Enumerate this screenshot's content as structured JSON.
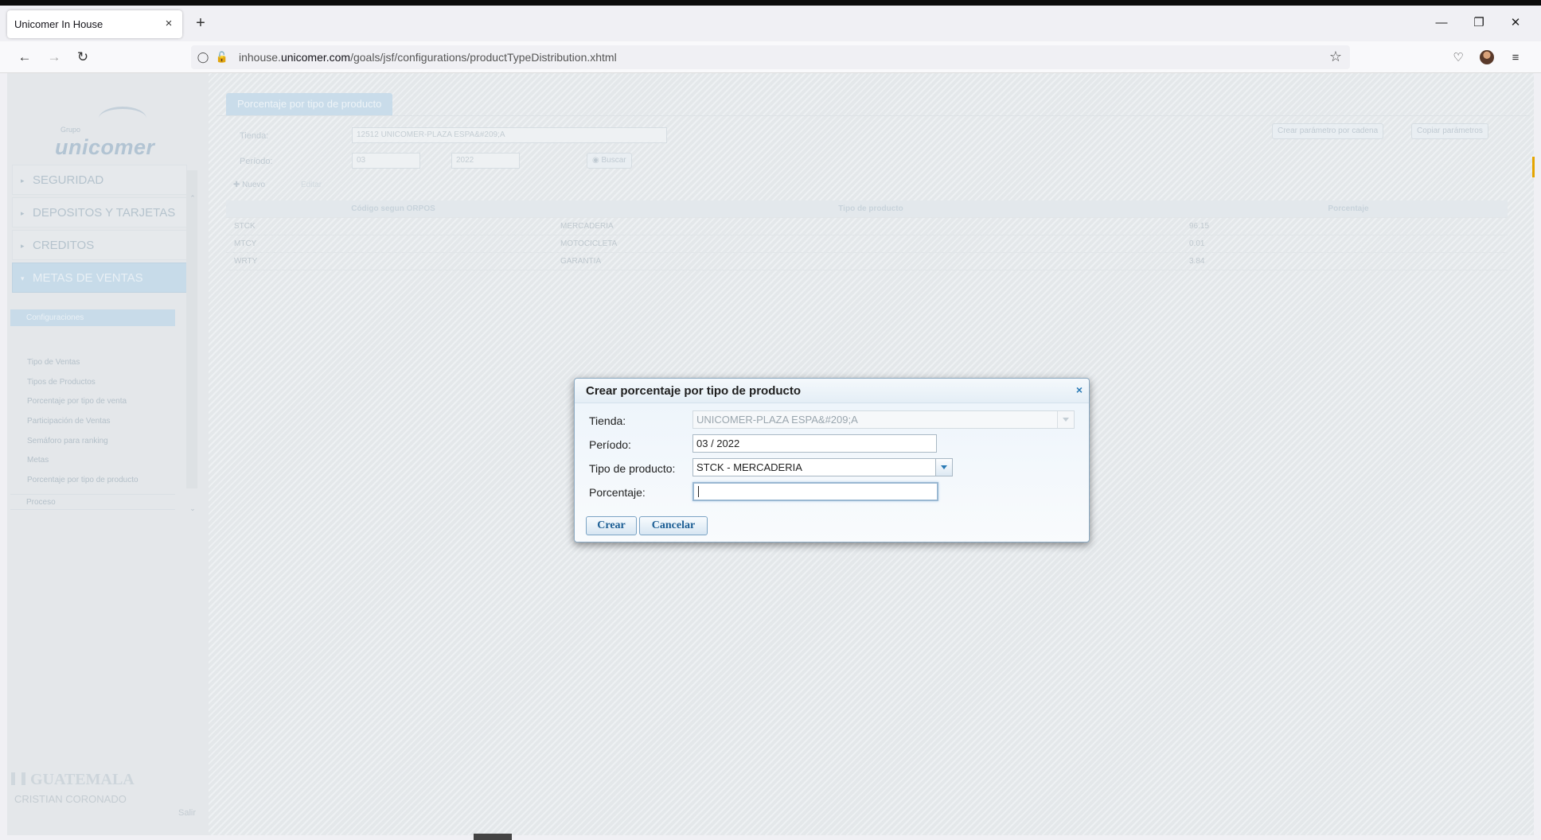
{
  "browser": {
    "tab_title": "Unicomer In House",
    "tab_close": "×",
    "new_tab": "+",
    "url_prefix": "inhouse.",
    "url_domain": "unicomer.com",
    "url_path": "/goals/jsf/configurations/productTypeDistribution.xhtml"
  },
  "sidebar": {
    "logo_small": "Grupo",
    "logo": "unicomer",
    "menu": [
      {
        "label": "SEGURIDAD"
      },
      {
        "label": "DEPOSITOS Y TARJETAS"
      },
      {
        "label": "CREDITOS"
      },
      {
        "label": "METAS DE VENTAS"
      }
    ],
    "submenu_head": "Configuraciones",
    "submenu": [
      "Tipo de Ventas",
      "Tipos de Productos",
      "Porcentaje por tipo de venta",
      "Participación de Ventas",
      "Semáforo para ranking",
      "Metas",
      "Porcentaje por tipo de producto"
    ],
    "submenu_proc": "Proceso",
    "country": "GUATEMALA",
    "user": "CRISTIAN CORONADO",
    "logout": "Salir"
  },
  "main": {
    "title": "Porcentaje por tipo de producto",
    "store_label": "Tienda:",
    "store_value": "12512 UNICOMER-PLAZA ESPA&#209;A",
    "period_label": "Período:",
    "period_month": "03",
    "period_year": "2022",
    "search_btn": "Buscar",
    "new_btn": "Nuevo",
    "edit_btn": "Editar",
    "create_chain_btn": "Crear parámetro por cadena",
    "copy_btn": "Copiar parámetros",
    "table": {
      "headers": [
        "Código segun ORPOS",
        "Tipo de producto",
        "Porcentaje"
      ],
      "rows": [
        [
          "STCK",
          "MERCADERIA",
          "96.15"
        ],
        [
          "MTCY",
          "MOTOCICLETA",
          "0.01"
        ],
        [
          "WRTY",
          "GARANTIA",
          "3.84"
        ]
      ]
    }
  },
  "dialog": {
    "title": "Crear porcentaje por tipo de producto",
    "close": "×",
    "store_label": "Tienda:",
    "store_value": "UNICOMER-PLAZA ESPA&#209;A",
    "period_label": "Período:",
    "period_value": "03 / 2022",
    "type_label": "Tipo de producto:",
    "type_value": "STCK - MERCADERIA",
    "percent_label": "Porcentaje:",
    "percent_value": "",
    "create_btn": "Crear",
    "cancel_btn": "Cancelar"
  }
}
